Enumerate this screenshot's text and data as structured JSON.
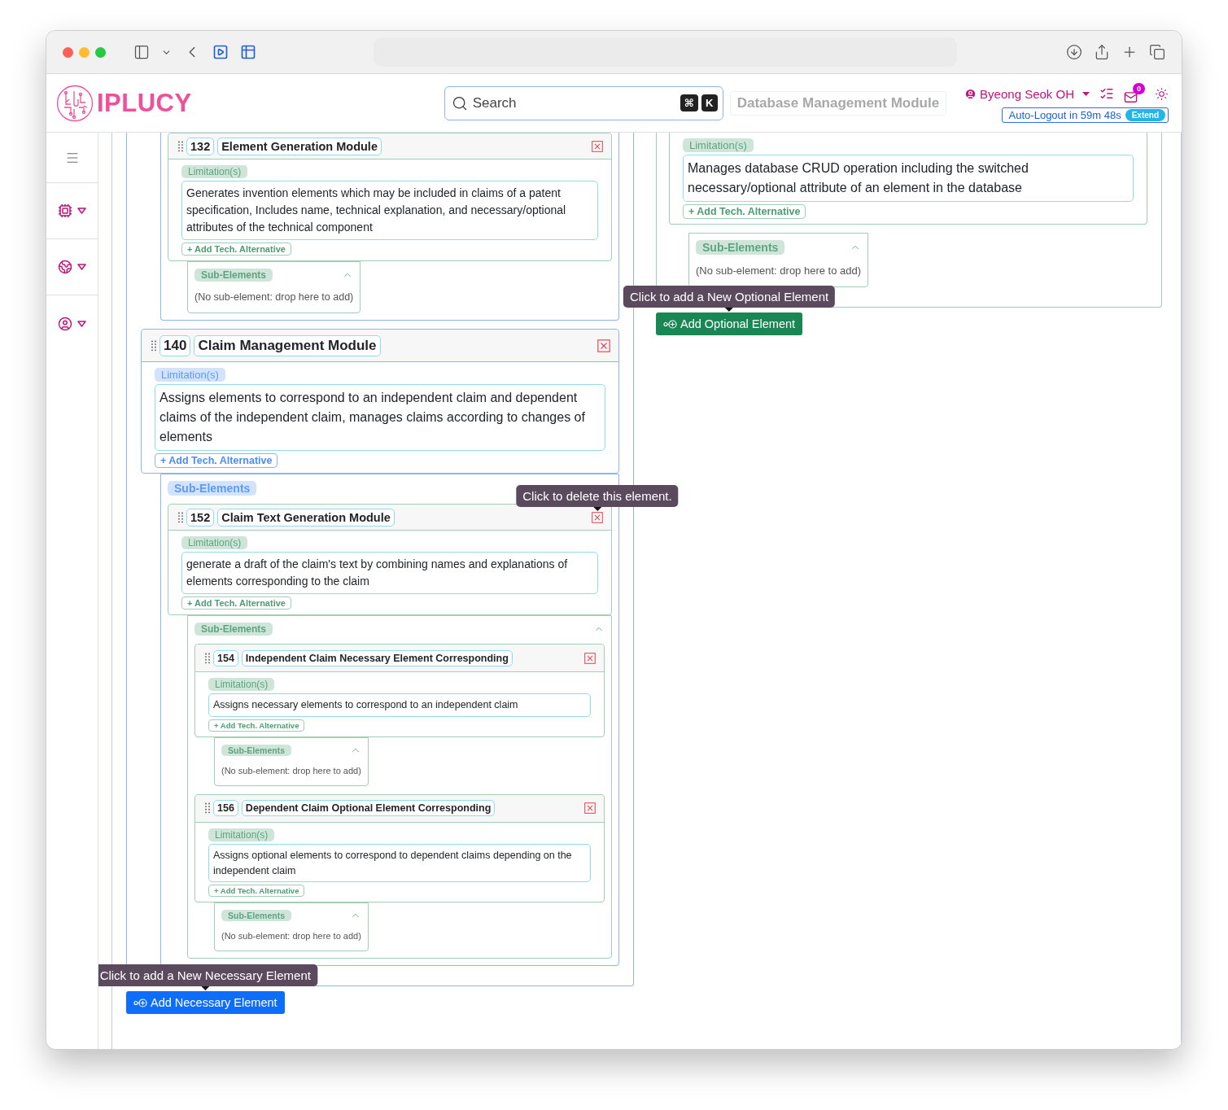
{
  "header": {
    "logo": "IPLUCY",
    "search": {
      "placeholder": "Search",
      "keys": [
        "⌘",
        "K"
      ]
    },
    "faded_title": "Database Management Module",
    "user": "Byeong Seok OH",
    "mail_count": "0",
    "auto_logout": "Auto-Logout in 59m 48s",
    "extend": "Extend"
  },
  "necessary_group": {
    "items": [
      {
        "kind": "continued_sub",
        "children": [
          {
            "kind": "element",
            "number": "132",
            "name": "Element Generation Module",
            "limitation_label": "Limitation(s)",
            "limitation": "Generates invention elements which may be included in claims of a patent specification, Includes name, technical explanation, and necessary/optional attributes of the technical component",
            "add_alt": "+ Add Tech. Alternative",
            "sub": {
              "label": "Sub-Elements",
              "empty": "(No sub-element: drop here to add)"
            }
          }
        ]
      },
      {
        "kind": "element",
        "number": "140",
        "name": "Claim Management Module",
        "limitation_label": "Limitation(s)",
        "limitation": "Assigns elements to correspond to an independent claim and dependent claims of the independent claim, manages claims according to changes of elements",
        "add_alt": "+ Add Tech. Alternative",
        "sub": {
          "label": "Sub-Elements",
          "children": [
            {
              "kind": "element",
              "number": "152",
              "name": "Claim Text Generation Module",
              "tooltip": "Click to delete this element.",
              "limitation_label": "Limitation(s)",
              "limitation": "generate a draft of the claim's text by combining names and explanations of elements corresponding to the claim",
              "add_alt": "+ Add Tech. Alternative",
              "sub": {
                "label": "Sub-Elements",
                "children": [
                  {
                    "kind": "element",
                    "number": "154",
                    "name": "Independent Claim Necessary Element Corresponding",
                    "limitation_label": "Limitation(s)",
                    "limitation": "Assigns necessary elements to correspond to an independent claim",
                    "add_alt": "+ Add Tech. Alternative",
                    "sub": {
                      "label": "Sub-Elements",
                      "empty": "(No sub-element: drop here to add)"
                    }
                  },
                  {
                    "kind": "element",
                    "number": "156",
                    "name": "Dependent Claim Optional Element Corresponding",
                    "limitation_label": "Limitation(s)",
                    "limitation": "Assigns optional elements to correspond to dependent claims depending on the independent claim",
                    "add_alt": "+ Add Tech. Alternative",
                    "sub": {
                      "label": "Sub-Elements",
                      "empty": "(No sub-element: drop here to add)"
                    }
                  }
                ]
              }
            }
          ]
        }
      }
    ],
    "button": "Add Necessary Element",
    "tooltip": "Click to add a New Necessary Element"
  },
  "optional_group": {
    "items": [
      {
        "kind": "continued_element",
        "limitation_label": "Limitation(s)",
        "limitation": "Manages database CRUD operation including the switched necessary/optional attribute of an element in the database",
        "add_alt": "+ Add Tech. Alternative",
        "sub": {
          "label": "Sub-Elements",
          "empty": "(No sub-element: drop here to add)"
        }
      }
    ],
    "button": "Add Optional Element",
    "tooltip": "Click to add a New Optional Element"
  }
}
